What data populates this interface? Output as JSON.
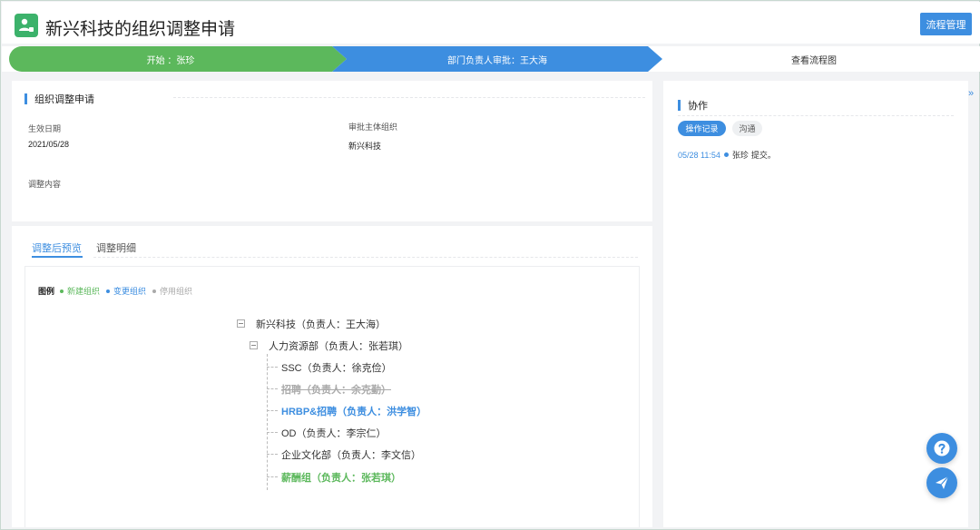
{
  "header": {
    "title": "新兴科技的组织调整申请",
    "flow_button": "流程管理"
  },
  "progress": {
    "steps": [
      {
        "label": "开始   ：张珍",
        "status": "done"
      },
      {
        "label": "部门负责人审批：王大海",
        "status": "current"
      },
      {
        "label": "查看流程图",
        "status": "link"
      }
    ]
  },
  "info": {
    "title": "组织调整申请",
    "fields": {
      "effective_date_label": "生效日期",
      "effective_date_value": "2021/05/28",
      "approval_org_label": "审批主体组织",
      "approval_org_value": "新兴科技",
      "content_label": "调整内容"
    }
  },
  "preview": {
    "tabs": [
      "调整后预览",
      "调整明细"
    ],
    "legend": {
      "title": "图例",
      "items": [
        {
          "label": "新建组织",
          "color": "#5cb85c"
        },
        {
          "label": "变更组织",
          "color": "#3d8ee0"
        },
        {
          "label": "停用组织",
          "color": "#aaaaaa"
        }
      ]
    },
    "tree": {
      "root": "新兴科技（负责人：王大海）",
      "dept": "人力资源部（负责人：张若琪）",
      "children": [
        {
          "label": "SSC（负责人：徐克俭）",
          "status": "normal"
        },
        {
          "label": "招聘（负责人：余克勤）",
          "status": "disabled"
        },
        {
          "label": "HRBP&招聘（负责人：洪学智）",
          "status": "changed"
        },
        {
          "label": "OD（负责人：李宗仁）",
          "status": "normal"
        },
        {
          "label": "企业文化部（负责人：李文信）",
          "status": "normal"
        },
        {
          "label": "薪酬组（负责人：张若琪）",
          "status": "new"
        }
      ]
    }
  },
  "collab": {
    "title": "协作",
    "tabs": [
      "操作记录",
      "沟通"
    ],
    "log": {
      "time": "05/28  11:54",
      "user": "张珍",
      "action": "提交。"
    }
  },
  "icons": {
    "app": "user-org-icon",
    "collapse": "double-chevron-right-icon",
    "help": "question-icon",
    "send": "paper-plane-icon"
  },
  "colors": {
    "primary": "#3d8ee0",
    "success": "#5cb85c",
    "muted": "#aaaaaa"
  }
}
